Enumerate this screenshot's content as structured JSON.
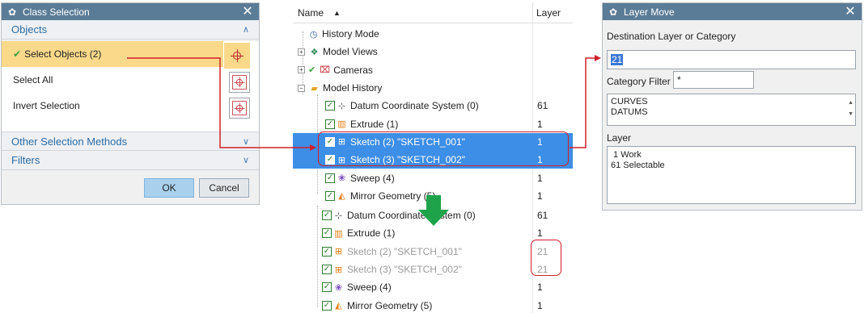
{
  "class_selection": {
    "title": "Class Selection",
    "sections": {
      "objects": "Objects",
      "other_methods": "Other Selection Methods",
      "filters": "Filters"
    },
    "rows": {
      "select_objects": "Select Objects (2)",
      "select_all": "Select All",
      "invert_selection": "Invert Selection"
    },
    "buttons": {
      "ok": "OK",
      "cancel": "Cancel"
    }
  },
  "navigator": {
    "columns": {
      "name": "Name",
      "layer": "Layer"
    },
    "top_rows": [
      {
        "label": "History Mode",
        "layer": ""
      },
      {
        "label": "Model Views",
        "layer": ""
      },
      {
        "label": "Cameras",
        "layer": ""
      },
      {
        "label": "Model History",
        "layer": ""
      },
      {
        "label": "Datum Coordinate System (0)",
        "layer": "61"
      },
      {
        "label": "Extrude (1)",
        "layer": "1"
      },
      {
        "label": "Sketch (2) \"SKETCH_001\"",
        "layer": "1"
      },
      {
        "label": "Sketch (3) \"SKETCH_002\"",
        "layer": "1"
      },
      {
        "label": "Sweep (4)",
        "layer": "1"
      },
      {
        "label": "Mirror Geometry (5)",
        "layer": "1"
      }
    ],
    "bottom_rows": [
      {
        "label": "Datum Coordinate System (0)",
        "layer": "61"
      },
      {
        "label": "Extrude (1)",
        "layer": "1"
      },
      {
        "label": "Sketch (2) \"SKETCH_001\"",
        "layer": "21"
      },
      {
        "label": "Sketch (3) \"SKETCH_002\"",
        "layer": "21"
      },
      {
        "label": "Sweep (4)",
        "layer": "1"
      },
      {
        "label": "Mirror Geometry (5)",
        "layer": "1"
      }
    ]
  },
  "layer_move": {
    "title": "Layer Move",
    "destination_label": "Destination Layer or Category",
    "destination_value": "21",
    "category_filter_label": "Category Filter",
    "category_filter_value": "*",
    "categories": [
      "CURVES",
      "DATUMS"
    ],
    "layer_label": "Layer",
    "layers": [
      " 1 Work",
      "61 Selectable"
    ]
  },
  "colors": {
    "title_bar": "#5b7c97",
    "selection": "#3d8ee6",
    "highlight": "#fbd98a",
    "annotation_red": "#d0202a",
    "annotation_green": "#1fa34a"
  }
}
